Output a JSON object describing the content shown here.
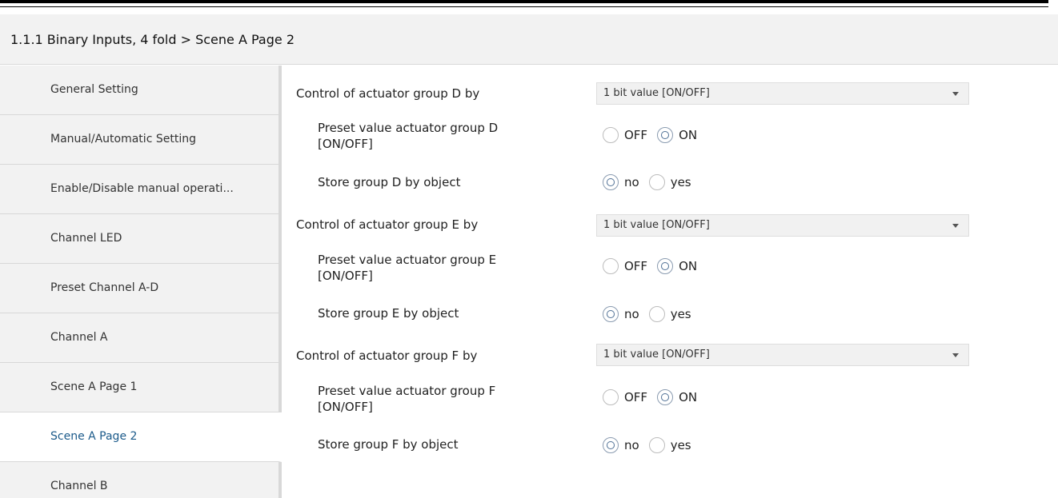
{
  "header": {
    "title": "1.1.1 Binary Inputs, 4 fold > Scene A Page 2"
  },
  "sidebar": {
    "items": [
      {
        "label": "General Setting",
        "active": false
      },
      {
        "label": "Manual/Automatic Setting",
        "active": false
      },
      {
        "label": "Enable/Disable manual operati...",
        "active": false
      },
      {
        "label": "Channel LED",
        "active": false
      },
      {
        "label": "Preset Channel A-D",
        "active": false
      },
      {
        "label": "Channel A",
        "active": false
      },
      {
        "label": "Scene A Page 1",
        "active": false
      },
      {
        "label": "Scene A Page 2",
        "active": true
      },
      {
        "label": "Channel B",
        "active": false
      }
    ]
  },
  "groups": [
    {
      "control_label": "Control of actuator group D by",
      "control_value": "1 bit value [ON/OFF]",
      "preset_label_line1": "Preset value actuator group D",
      "preset_label_line2": "[ON/OFF]",
      "preset_options": [
        "OFF",
        "ON"
      ],
      "preset_selected": "ON",
      "store_label": "Store group D by object",
      "store_options": [
        "no",
        "yes"
      ],
      "store_selected": "no"
    },
    {
      "control_label": "Control of actuator group E by",
      "control_value": "1 bit value [ON/OFF]",
      "preset_label_line1": "Preset value actuator group E",
      "preset_label_line2": "[ON/OFF]",
      "preset_options": [
        "OFF",
        "ON"
      ],
      "preset_selected": "ON",
      "store_label": "Store group E by object",
      "store_options": [
        "no",
        "yes"
      ],
      "store_selected": "no"
    },
    {
      "control_label": "Control of actuator group F by",
      "control_value": "1 bit value [ON/OFF]",
      "preset_label_line1": "Preset value actuator group F",
      "preset_label_line2": "[ON/OFF]",
      "preset_options": [
        "OFF",
        "ON"
      ],
      "preset_selected": "ON",
      "store_label": "Store group F by object",
      "store_options": [
        "no",
        "yes"
      ],
      "store_selected": "no"
    }
  ]
}
